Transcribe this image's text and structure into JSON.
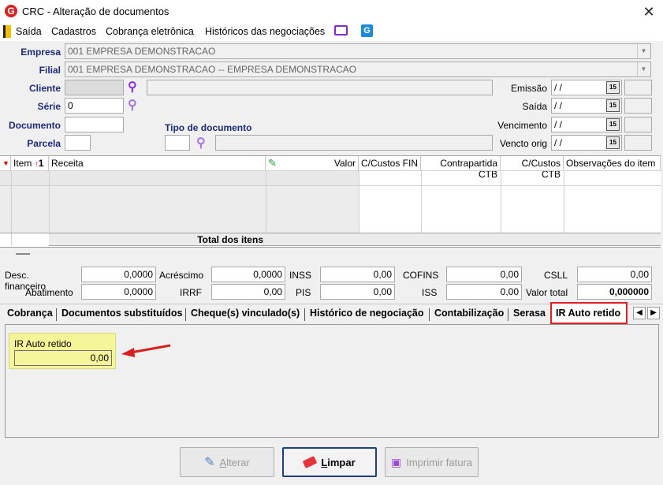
{
  "window": {
    "title": "CRC - Alteração de documentos",
    "app_icon": "G"
  },
  "menu": [
    "Saída",
    "Cadastros",
    "Cobrança eletrônica",
    "Históricos das negociações"
  ],
  "form": {
    "empresa_label": "Empresa",
    "empresa_value": "001 EMPRESA DEMONSTRACAO",
    "filial_label": "Filial",
    "filial_value": "001 EMPRESA DEMONSTRACAO -- EMPRESA DEMONSTRACAO",
    "cliente_label": "Cliente",
    "serie_label": "Série",
    "serie_value": "0",
    "documento_label": "Documento",
    "tipo_label": "Tipo de documento",
    "parcela_label": "Parcela",
    "emissao_label": "Emissão",
    "saida_label": "Saída",
    "vencimento_label": "Vencimento",
    "vencto_label": "Vencto orig",
    "date_placeholder": " / /"
  },
  "grid": {
    "columns": [
      "Item",
      "Receita",
      "Valor",
      "C/Custos FIN",
      "Contrapartida CTB",
      "C/Custos CTB",
      "Observações do item"
    ],
    "sort_marker": "1",
    "total_label": "Total dos itens"
  },
  "totals": {
    "desc_fin_label": "Desc. financeiro",
    "desc_fin": "0,0000",
    "acrescimo_label": "Acréscimo",
    "acrescimo": "0,0000",
    "inss_label": "INSS",
    "inss": "0,00",
    "cofins_label": "COFINS",
    "cofins": "0,00",
    "csll_label": "CSLL",
    "csll": "0,00",
    "abatimento_label": "Abatimento",
    "abatimento": "0,0000",
    "irrf_label": "IRRF",
    "irrf": "0,00",
    "pis_label": "PIS",
    "pis": "0,00",
    "iss_label": "ISS",
    "iss": "0,00",
    "valor_total_label": "Valor total",
    "valor_total": "0,000000"
  },
  "tabs": [
    "Cobrança",
    "Documentos substituídos",
    "Cheque(s) vinculado(s)",
    "Histórico de negociação",
    "Contabilização",
    "Serasa",
    "IR Auto retido"
  ],
  "ir_panel": {
    "label": "IR Auto retido",
    "value": "0,00"
  },
  "buttons": {
    "alterar_prefix": "A",
    "alterar_rest": "lterar",
    "limpar_prefix": "L",
    "limpar_rest": "impar",
    "imprimir": "Imprimir fatura"
  },
  "colors": {
    "label_blue": "#1c2a78",
    "highlight_red": "#e02020",
    "ir_yellow": "#f5f59a"
  }
}
